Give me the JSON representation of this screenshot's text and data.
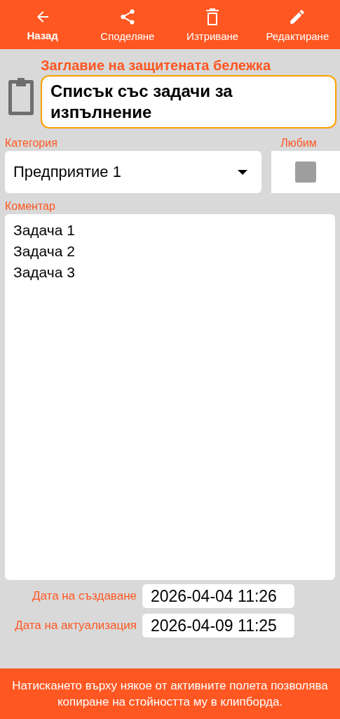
{
  "toolbar": [
    {
      "kind": "back",
      "label": "Назад",
      "selected": true
    },
    {
      "kind": "share",
      "label": "Споделяне",
      "selected": false
    },
    {
      "kind": "delete",
      "label": "Изтриване",
      "selected": false
    },
    {
      "kind": "edit",
      "label": "Редактиране",
      "selected": false
    }
  ],
  "title": {
    "label": "Заглавие на защитената бележка",
    "value": "Списък със задачи за изпълнение"
  },
  "category": {
    "label": "Категория",
    "value": "Предприятие 1"
  },
  "favorite": {
    "label": "Любим",
    "checked": false
  },
  "comment": {
    "label": "Коментар",
    "lines": [
      "Задача 1",
      "Задача 2",
      "Задача 3"
    ]
  },
  "dates": [
    {
      "label": "Дата на създаване",
      "value": "2026-04-04 11:26"
    },
    {
      "label": "Дата на актуализация",
      "value": "2026-04-09 11:25"
    }
  ],
  "footer": "Натискането върху някое от активните полета позволява копиране на стойността му в клипборда."
}
